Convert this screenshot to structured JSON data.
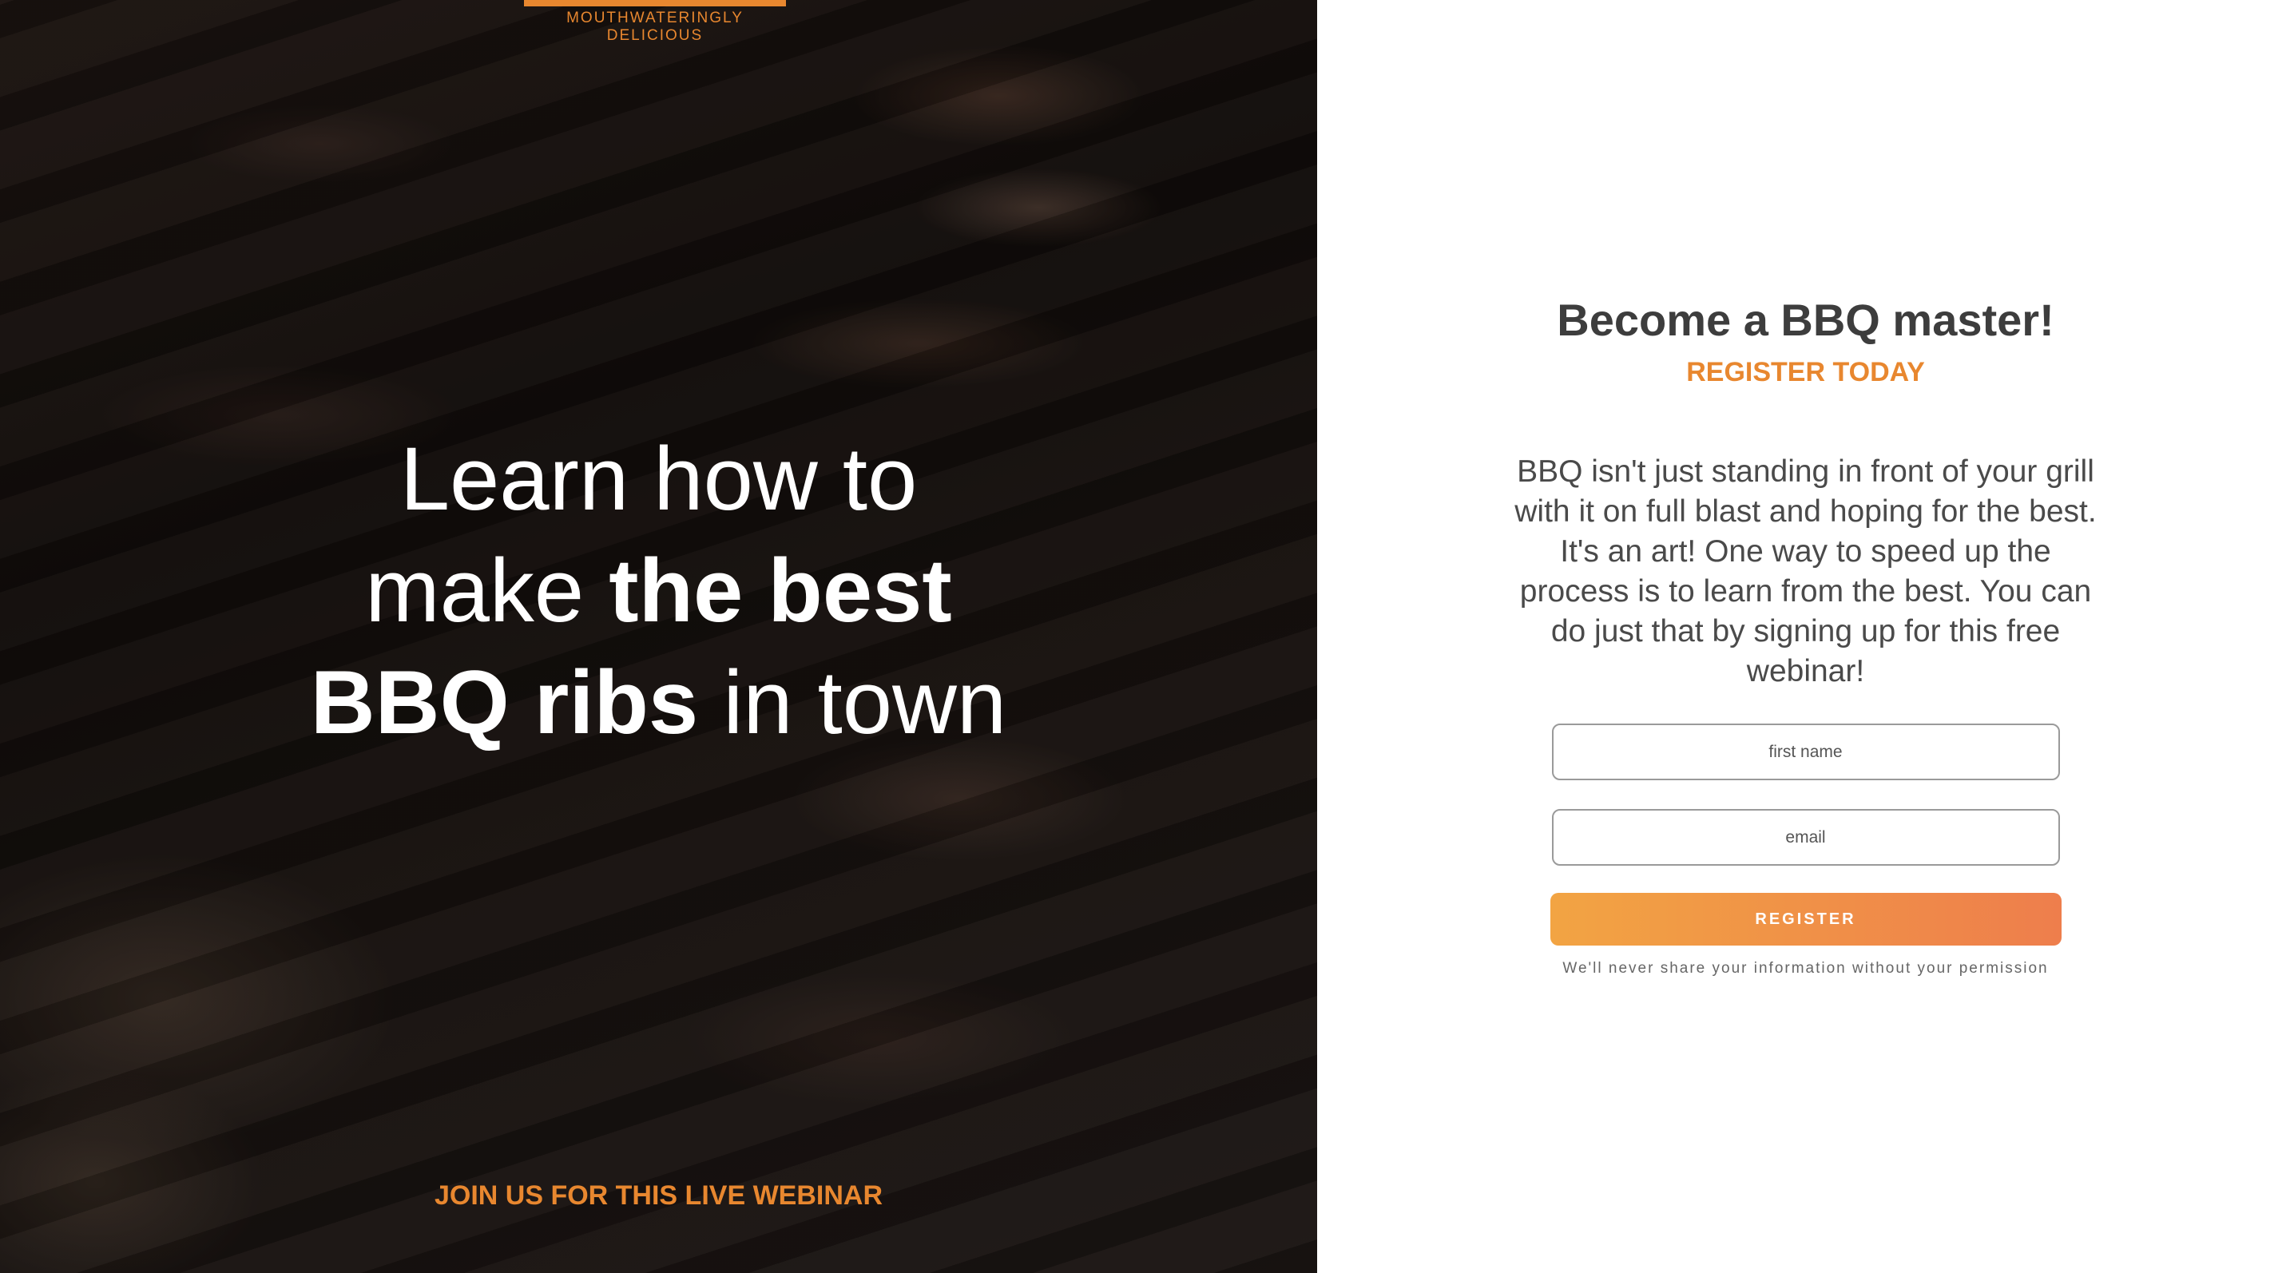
{
  "hero": {
    "tagline": "MOUTHWATERINGLY DELICIOUS",
    "headline": {
      "line1": "Learn how to",
      "line2_light": "make ",
      "line2_bold": "the best",
      "line3_bold": "BBQ ribs",
      "line3_light": " in town"
    },
    "cta": "JOIN US FOR THIS LIVE WEBINAR"
  },
  "form": {
    "title": "Become a BBQ master!",
    "subtitle": "REGISTER TODAY",
    "description": "BBQ isn't just standing in front of your grill with it on full blast and hoping for the best. It's an art! One way to speed up the process is to learn from the best. You can do just that by signing up for this free webinar!",
    "first_name_placeholder": "first name",
    "email_placeholder": "email",
    "register_label": "REGISTER",
    "privacy_note": "We'll never share your information without your permission"
  },
  "colors": {
    "accent": "#e8872f",
    "button_start": "#f2a443",
    "button_end": "#ee7e4c"
  }
}
